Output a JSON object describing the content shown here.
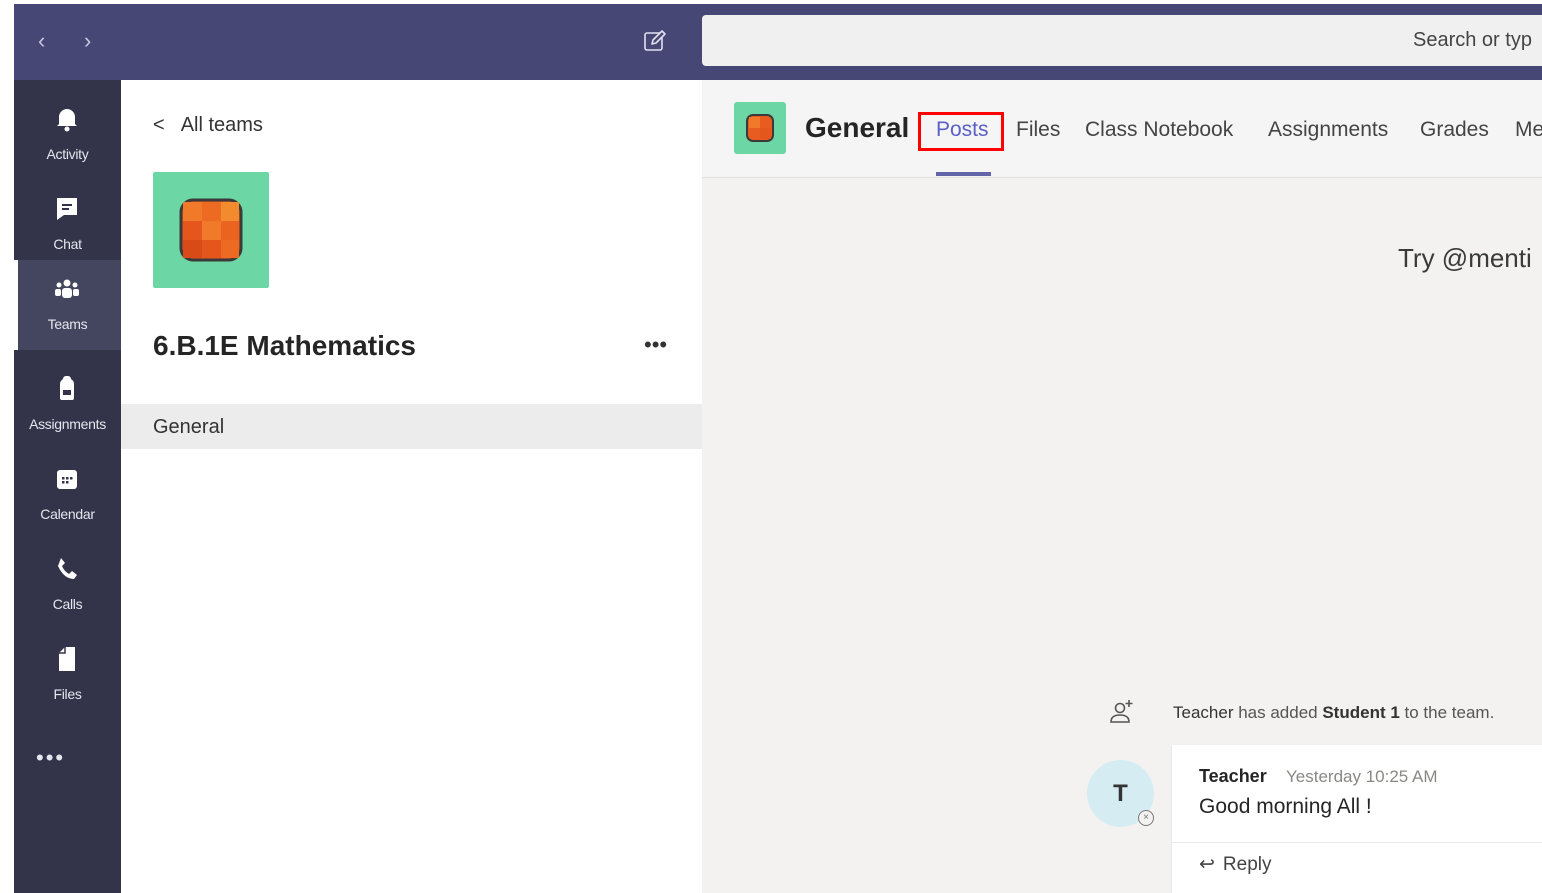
{
  "titlebar": {
    "back_arrow": "‹",
    "forward_arrow": "›",
    "compose_icon": "compose-icon",
    "search_placeholder": "Search or typ"
  },
  "rail": {
    "items": [
      {
        "label": "Activity",
        "icon": "bell-icon"
      },
      {
        "label": "Chat",
        "icon": "chat-icon"
      },
      {
        "label": "Teams",
        "icon": "teams-icon",
        "active": true
      },
      {
        "label": "Assignments",
        "icon": "backpack-icon"
      },
      {
        "label": "Calendar",
        "icon": "calendar-icon"
      },
      {
        "label": "Calls",
        "icon": "phone-icon"
      },
      {
        "label": "Files",
        "icon": "file-icon"
      }
    ],
    "more": "•••"
  },
  "teampane": {
    "back_label": "All teams",
    "team_name": "6.B.1E Mathematics",
    "more": "•••",
    "channels": [
      "General"
    ]
  },
  "channel": {
    "title": "General",
    "tabs": [
      "Posts",
      "Files",
      "Class Notebook",
      "Assignments",
      "Grades",
      "Me"
    ],
    "active_tab": "Posts"
  },
  "feed": {
    "hint": "Try @menti",
    "system_message": {
      "actor": "Teacher",
      "middle": " has added ",
      "target": "Student 1",
      "end": " to the team."
    },
    "message": {
      "avatar_initial": "T",
      "author": "Teacher",
      "time": "Yesterday 10:25 AM",
      "body": "Good morning All !",
      "reply_label": "Reply"
    }
  },
  "colors": {
    "titlebar": "#464775",
    "rail": "#33344a",
    "accent": "#6264a7",
    "team_avatar_bg": "#6cd7a4",
    "highlight_box": "#ff0000"
  }
}
